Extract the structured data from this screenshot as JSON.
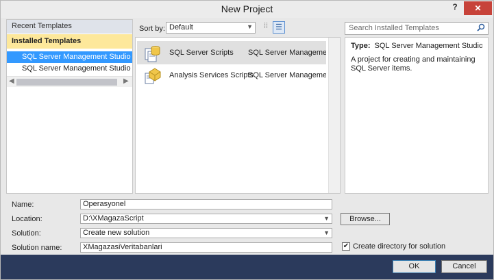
{
  "window": {
    "title": "New Project",
    "help_label": "?",
    "close_label": "✕"
  },
  "sidebar": {
    "recent_header": "Recent Templates",
    "installed_header": "Installed Templates",
    "items": [
      {
        "label": "SQL Server Management Studio Projects",
        "selected": true
      },
      {
        "label": "SQL Server Management Studio Solutions",
        "selected": false
      }
    ]
  },
  "toolbar": {
    "sort_label": "Sort by:",
    "sort_value": "Default"
  },
  "search": {
    "placeholder": "Search Installed Templates"
  },
  "templates": [
    {
      "name": "SQL Server Scripts",
      "lang": "SQL Server Management Studio Projects",
      "icon": "sql-scripts-icon",
      "selected": true
    },
    {
      "name": "Analysis Services Scripts",
      "lang": "SQL Server Management Studio Projects",
      "icon": "analysis-scripts-icon",
      "selected": false
    }
  ],
  "details": {
    "type_label": "Type:",
    "type_value": "SQL Server Management Studio Projects",
    "description": "A project for creating and maintaining SQL Server items."
  },
  "form": {
    "name_label": "Name:",
    "name_value": "Operasyonel",
    "location_label": "Location:",
    "location_value": "D:\\XMagazaScript",
    "browse_label": "Browse...",
    "solution_label": "Solution:",
    "solution_value": "Create new solution",
    "solution_name_label": "Solution name:",
    "solution_name_value": "XMagazasiVeritabanlari",
    "create_dir_label": "Create directory for solution",
    "create_dir_checked": true
  },
  "footer": {
    "ok_label": "OK",
    "cancel_label": "Cancel"
  },
  "colors": {
    "selection": "#3399ff",
    "installed_header": "#fde89b",
    "footer": "#2b3a5c",
    "close": "#c7433a"
  }
}
